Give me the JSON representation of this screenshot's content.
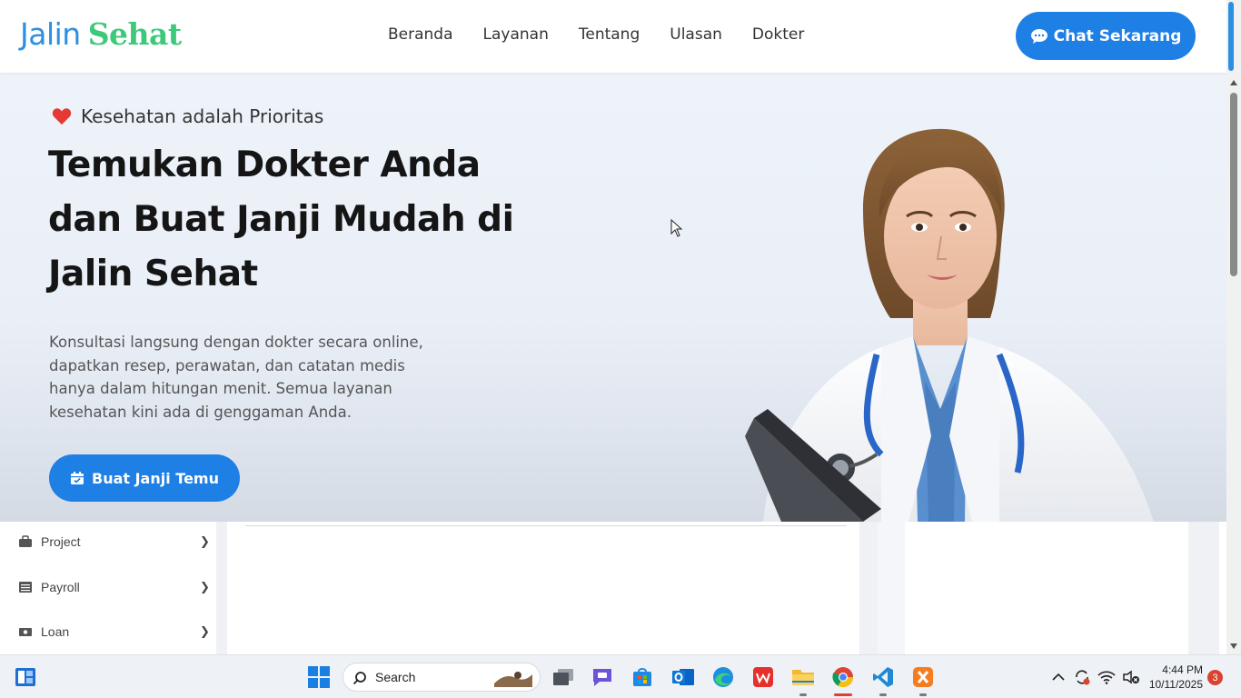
{
  "site": {
    "logo_part1": "Jalin",
    "logo_part2": "Sehat",
    "nav": [
      "Beranda",
      "Layanan",
      "Tentang",
      "Ulasan",
      "Dokter"
    ],
    "chat_button": "Chat Sekarang"
  },
  "hero": {
    "tagline": "Kesehatan adalah Prioritas",
    "title_lines": [
      "Temukan Dokter Anda",
      "dan Buat Janji Mudah di",
      "Jalin Sehat"
    ],
    "description_lines": [
      "Konsultasi langsung dengan dokter secara online,",
      "dapatkan resep, perawatan, dan catatan medis",
      "hanya dalam hitungan menit. Semua layanan",
      "kesehatan kini ada di genggaman Anda."
    ],
    "cta_label": "Buat Janji Temu"
  },
  "app_sidebar": {
    "items": [
      {
        "label": "Project",
        "icon": "briefcase-icon"
      },
      {
        "label": "Payroll",
        "icon": "list-icon"
      },
      {
        "label": "Loan",
        "icon": "cash-icon"
      }
    ]
  },
  "taskbar": {
    "search_label": "Search",
    "time": "4:44 PM",
    "date": "10/11/2025",
    "notification_count": "3"
  },
  "colors": {
    "brand_blue": "#1e7fe5",
    "logo_green": "#3ec97a",
    "heart_red": "#e53935"
  }
}
